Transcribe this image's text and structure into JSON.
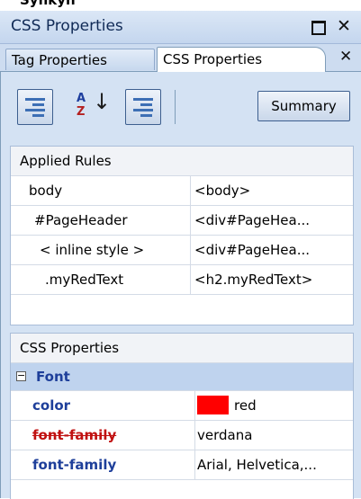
{
  "topcrop": {
    "text": "Synkyh"
  },
  "window": {
    "title": "CSS Properties"
  },
  "tabs": [
    {
      "label": "Tag Properties"
    },
    {
      "label": "CSS Properties"
    }
  ],
  "toolbar": {
    "summary_label": "Summary"
  },
  "applied_rules": {
    "title": "Applied Rules",
    "rows": [
      {
        "selector": "body",
        "element": "<body>"
      },
      {
        "selector": "#PageHeader",
        "element": "<div#PageHea..."
      },
      {
        "selector": "< inline style >",
        "element": "<div#PageHea..."
      },
      {
        "selector": ".myRedText",
        "element": "<h2.myRedText>"
      }
    ]
  },
  "css_properties": {
    "title": "CSS Properties",
    "group": {
      "label": "Font",
      "expander": "⊟"
    },
    "rows": [
      {
        "name": "color",
        "value": "red",
        "swatch": "#ff0000"
      },
      {
        "name": "font-family",
        "value": "verdana"
      },
      {
        "name": "font-family",
        "value": "Arial, Helvetica,..."
      }
    ]
  }
}
